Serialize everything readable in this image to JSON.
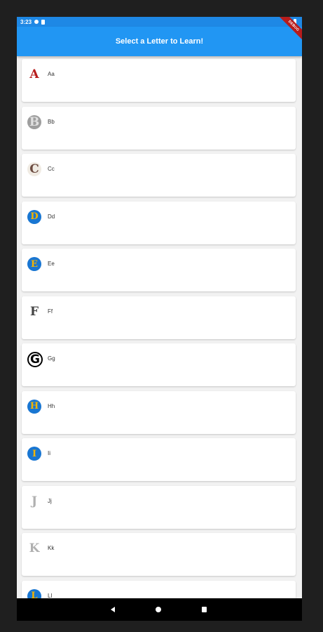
{
  "status_bar": {
    "time": "3:23"
  },
  "app_bar": {
    "title": "Select a Letter to Learn!",
    "debug_banner": "DEBUG"
  },
  "letters": [
    {
      "label": "Aa",
      "glyph": "A",
      "style": "red-letter"
    },
    {
      "label": "Bb",
      "glyph": "B",
      "style": "gray-stone"
    },
    {
      "label": "Cc",
      "glyph": "C",
      "style": "snail"
    },
    {
      "label": "Dd",
      "glyph": "D",
      "style": "blue-circle"
    },
    {
      "label": "Ee",
      "glyph": "E",
      "style": "blue-circle"
    },
    {
      "label": "Ff",
      "glyph": "F",
      "style": "plain"
    },
    {
      "label": "Gg",
      "glyph": "G",
      "style": "black-ring"
    },
    {
      "label": "Hh",
      "glyph": "H",
      "style": "blue-circle"
    },
    {
      "label": "Ii",
      "glyph": "I",
      "style": "blue-circle"
    },
    {
      "label": "Jj",
      "glyph": "J",
      "style": "faint"
    },
    {
      "label": "Kk",
      "glyph": "K",
      "style": "faint"
    },
    {
      "label": "Ll",
      "glyph": "L",
      "style": "blue-circle"
    }
  ],
  "colors": {
    "app_bar": "#2196f3",
    "status_bar": "#1e88e5",
    "blue_circle": "#1976d2",
    "red_letter": "#b71c1c"
  },
  "nav": {
    "back": "back-icon",
    "home": "home-icon",
    "recents": "recents-icon"
  }
}
